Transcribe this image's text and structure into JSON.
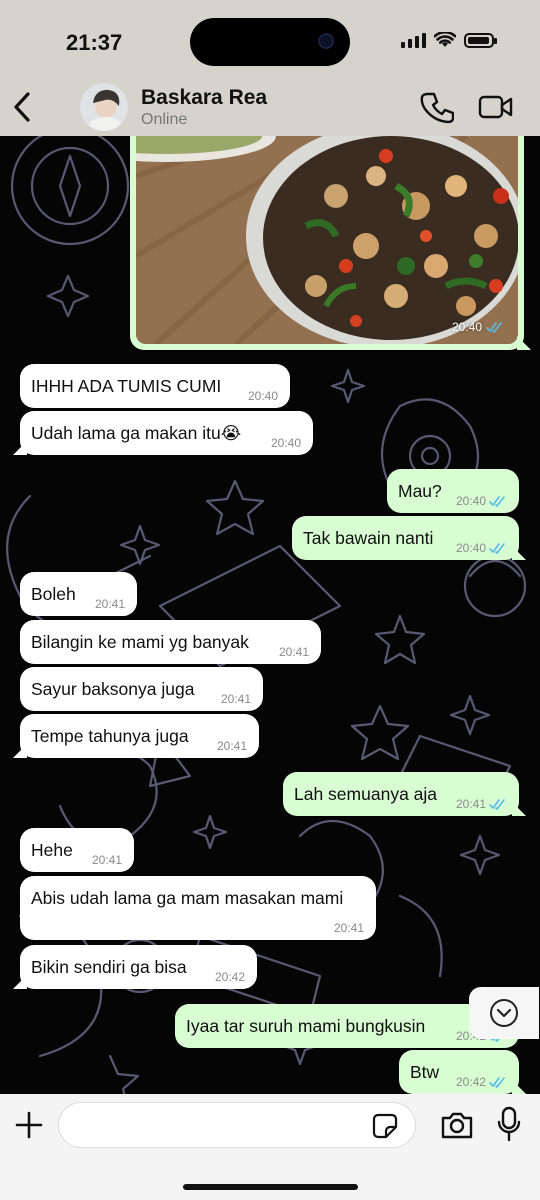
{
  "status_bar": {
    "time": "21:37",
    "battery_level": 0.85
  },
  "header": {
    "contact_name": "Baskara Rea",
    "contact_status": "Online",
    "icons": [
      "back-icon",
      "avatar",
      "phone-icon",
      "video-icon"
    ]
  },
  "image_message": {
    "time": "20:40",
    "read": true
  },
  "messages": [
    {
      "dir": "in",
      "text": "IHHH ADA TUMIS CUMI",
      "time": "20:40"
    },
    {
      "dir": "in",
      "text": "Udah lama ga makan itu😭",
      "time": "20:40"
    },
    {
      "dir": "out",
      "text": "Mau?",
      "time": "20:40",
      "read": true
    },
    {
      "dir": "out",
      "text": "Tak bawain nanti",
      "time": "20:40",
      "read": true
    },
    {
      "dir": "in",
      "text": "Boleh",
      "time": "20:41"
    },
    {
      "dir": "in",
      "text": "Bilangin ke mami yg banyak",
      "time": "20:41"
    },
    {
      "dir": "in",
      "text": "Sayur baksonya juga",
      "time": "20:41"
    },
    {
      "dir": "in",
      "text": "Tempe tahunya juga",
      "time": "20:41"
    },
    {
      "dir": "out",
      "text": "Lah semuanya aja",
      "time": "20:41",
      "read": true
    },
    {
      "dir": "in",
      "text": "Hehe",
      "time": "20:41"
    },
    {
      "dir": "in",
      "text": "Abis udah lama ga mam masakan mami",
      "time": "20:41"
    },
    {
      "dir": "in",
      "text": "Bikin sendiri ga bisa",
      "time": "20:42"
    },
    {
      "dir": "out",
      "text": "Iyaa tar suruh mami bungkusin",
      "time": "20:42",
      "read": true
    },
    {
      "dir": "out",
      "text": "Btw",
      "time": "20:42",
      "read": true
    }
  ],
  "composer": {
    "placeholder": "",
    "value": ""
  },
  "colors": {
    "incoming": "#ffffff",
    "outgoing": "#d9fdd3",
    "read_tick": "#53bdeb",
    "header_bg": "#d6d3cc"
  }
}
